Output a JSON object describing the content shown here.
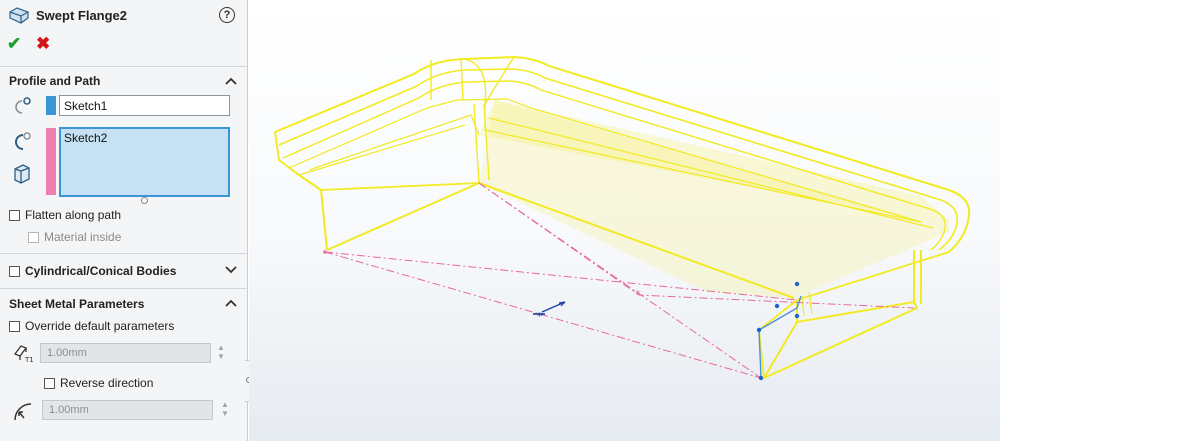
{
  "panel": {
    "title": "Swept Flange2",
    "help_label": "?",
    "ok_label": "✔",
    "cancel_label": "✖",
    "profile_path": {
      "header": "Profile and Path",
      "profile_value": "Sketch1",
      "path_value": "Sketch2",
      "profile_color": "#3a96d4",
      "path_color": "#ef7fb0",
      "flatten_label": "Flatten along path",
      "flatten_checked": false,
      "material_inside_label": "Material inside",
      "material_inside_enabled": false
    },
    "cylindrical": {
      "header": "Cylindrical/Conical Bodies",
      "checked": false
    },
    "sheet_metal": {
      "header": "Sheet Metal Parameters",
      "override_label": "Override default parameters",
      "override_checked": false,
      "thickness_value": "1.00mm",
      "reverse_label": "Reverse direction",
      "reverse_checked": false,
      "radius_value": "1.00mm"
    }
  },
  "colors": {
    "model_edge": "#f2ea22",
    "model_fill": "#f6f2a0",
    "sketch_line": "#e8689c",
    "selection_blue": "#1e63c8",
    "accept": "#1f9e32",
    "reject": "#d4161b"
  }
}
